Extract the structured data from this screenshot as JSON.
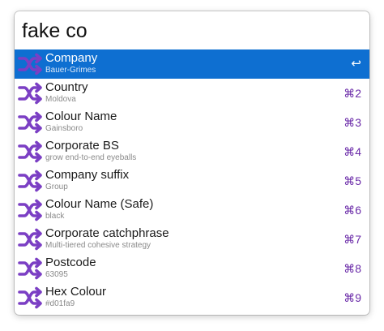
{
  "search": {
    "query": "fake co"
  },
  "colors": {
    "selection": "#0e6fd1",
    "icon": "#7b3fc4",
    "shortcut": "#6a2aa8"
  },
  "results": [
    {
      "title": "Company",
      "subtitle": "Bauer-Grimes",
      "shortcut": "↩",
      "icon": "shuffle-icon"
    },
    {
      "title": "Country",
      "subtitle": "Moldova",
      "shortcut": "⌘2",
      "icon": "shuffle-icon"
    },
    {
      "title": "Colour Name",
      "subtitle": "Gainsboro",
      "shortcut": "⌘3",
      "icon": "shuffle-icon"
    },
    {
      "title": "Corporate BS",
      "subtitle": "grow end-to-end eyeballs",
      "shortcut": "⌘4",
      "icon": "shuffle-icon"
    },
    {
      "title": "Company suffix",
      "subtitle": "Group",
      "shortcut": "⌘5",
      "icon": "shuffle-icon"
    },
    {
      "title": "Colour Name (Safe)",
      "subtitle": "black",
      "shortcut": "⌘6",
      "icon": "shuffle-icon"
    },
    {
      "title": "Corporate catchphrase",
      "subtitle": "Multi-tiered cohesive strategy",
      "shortcut": "⌘7",
      "icon": "shuffle-icon"
    },
    {
      "title": "Postcode",
      "subtitle": "63095",
      "shortcut": "⌘8",
      "icon": "shuffle-icon"
    },
    {
      "title": "Hex Colour",
      "subtitle": "#d01fa9",
      "shortcut": "⌘9",
      "icon": "shuffle-icon"
    }
  ]
}
